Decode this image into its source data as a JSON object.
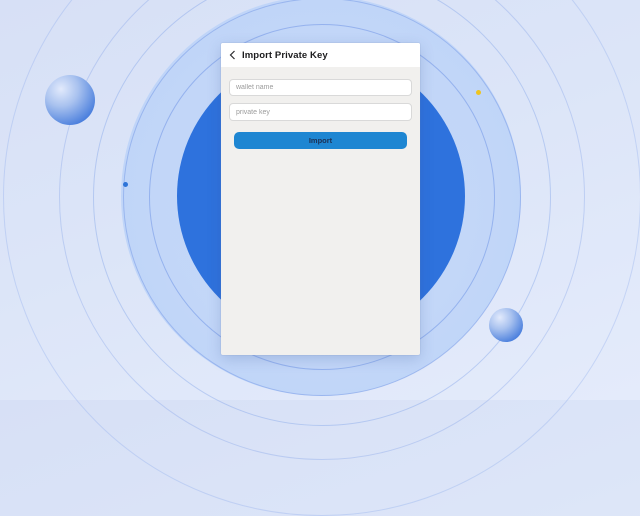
{
  "panel": {
    "header": {
      "title": "Import Private Key",
      "back_icon": "chevron-left-icon"
    },
    "form": {
      "wallet_name": {
        "value": "",
        "placeholder": "wallet name"
      },
      "private_key": {
        "value": "",
        "placeholder": "private key"
      },
      "import_button_label": "Import"
    }
  },
  "decorations": {
    "icons": [
      "gradient-orb",
      "gradient-orb",
      "blue-dot",
      "yellow-dot"
    ],
    "colors": {
      "big_circle_blue": "#2e72dd",
      "halo_blue": "#bed4f8",
      "button_blue": "#1e86d2",
      "button_text": "#1c3054",
      "panel_body": "#f1f0ee",
      "panel_header": "#ffffff",
      "background_top": "#d7e0f6",
      "background_bottom": "#e4ebfb",
      "blue_dot": "#2e74d8",
      "yellow_dot": "#eec41f"
    }
  }
}
